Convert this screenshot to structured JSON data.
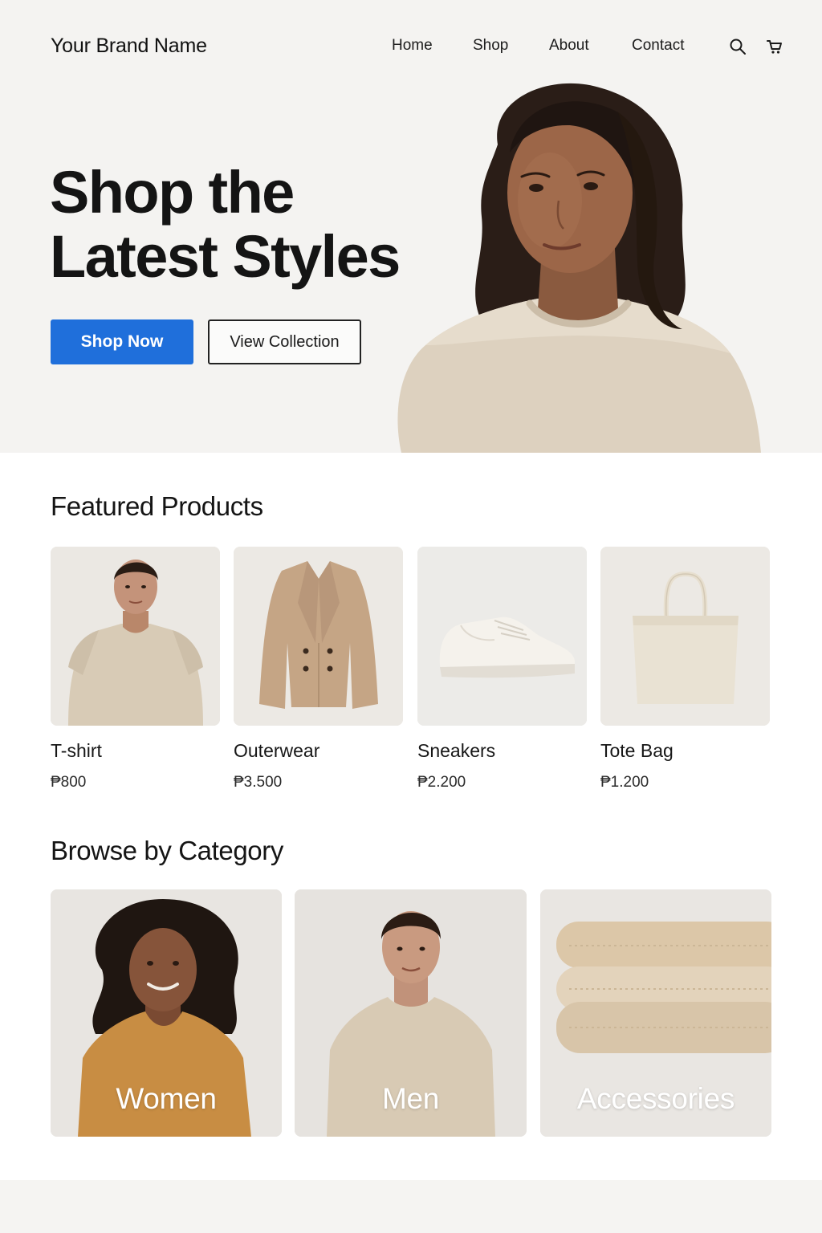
{
  "brand": {
    "name": "Your Brand Name"
  },
  "nav": {
    "links": [
      {
        "label": "Home"
      },
      {
        "label": "Shop"
      },
      {
        "label": "About"
      },
      {
        "label": "Contact"
      }
    ],
    "icons": [
      "search-icon",
      "cart-icon"
    ]
  },
  "hero": {
    "title_line1": "Shop the",
    "title_line2": "Latest Styles",
    "primary_cta": "Shop Now",
    "secondary_cta": "View Collection",
    "image": "woman-in-beige-sweater"
  },
  "featured": {
    "title": "Featured Products",
    "products": [
      {
        "name": "T-shirt",
        "price": "₱800",
        "image": "man-in-beige-tshirt"
      },
      {
        "name": "Outerwear",
        "price": "₱3.500",
        "image": "camel-peacoat"
      },
      {
        "name": "Sneakers",
        "price": "₱2.200",
        "image": "white-sneaker"
      },
      {
        "name": "Tote Bag",
        "price": "₱1.200",
        "image": "canvas-tote-bag"
      }
    ]
  },
  "categories": {
    "title": "Browse by Category",
    "items": [
      {
        "label": "Women",
        "image": "woman-in-mustard-tee"
      },
      {
        "label": "Men",
        "image": "man-in-beige-tee"
      },
      {
        "label": "Accessories",
        "image": "folded-knit-scarves"
      }
    ]
  },
  "colors": {
    "accent": "#1f6fdb",
    "hero_background": "#f4f3f1",
    "text": "#161616",
    "card_background": "#ebe8e3"
  }
}
